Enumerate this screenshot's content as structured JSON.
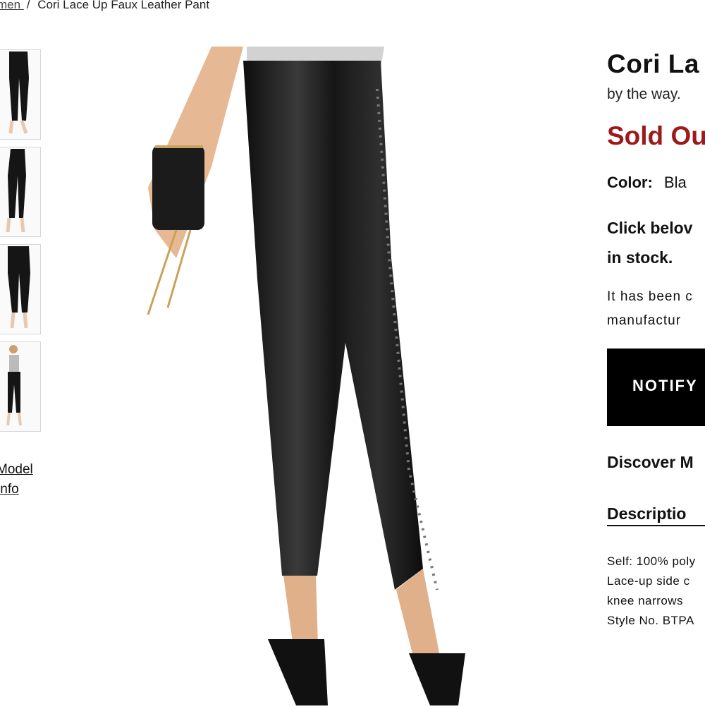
{
  "breadcrumb": {
    "parent": "men ",
    "separator": "/",
    "current": "Cori Lace Up Faux Leather Pant"
  },
  "gallery": {
    "thumbnails": [
      "front-view",
      "side-view",
      "back-view",
      "full-length-view"
    ],
    "model_info_line1": "Model",
    "model_info_line2": "Info"
  },
  "product": {
    "title": "Cori La",
    "brand": "by the way.",
    "status": "Sold Ou",
    "color_label": "Color:",
    "color_value": "Bla",
    "click_below_line1": "Click belov",
    "click_below_line2": "in stock.",
    "notice_line1": "It has been c",
    "notice_line2": "manufactur",
    "notify_label": "NOTIFY",
    "discover_label": "Discover M",
    "description_tab": "Descriptio",
    "description_lines": [
      "Self: 100% poly",
      "Lace-up side c",
      "knee narrows",
      "Style No. BTPA"
    ]
  },
  "colors": {
    "sold_out": "#9b1b1b",
    "button_bg": "#000000",
    "pant": "#151515"
  }
}
